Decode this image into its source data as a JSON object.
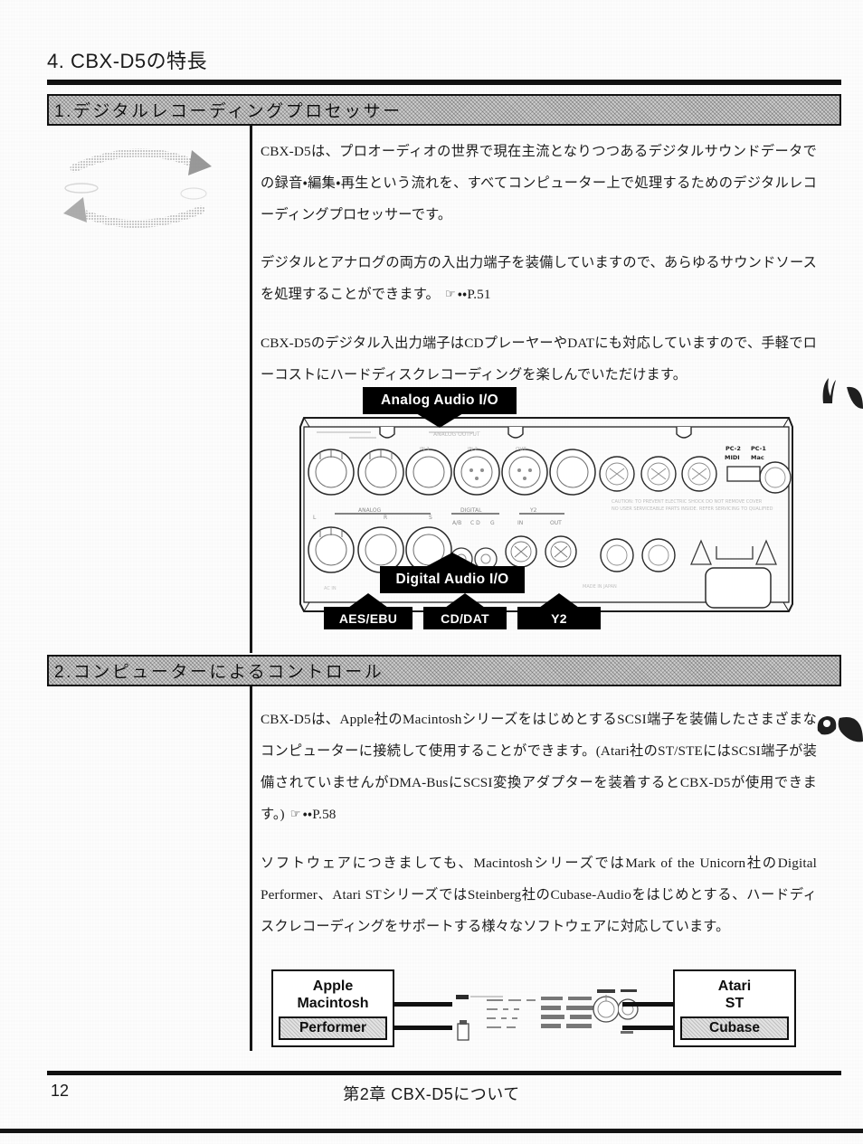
{
  "document": {
    "chapter_title": "4. CBX-D5の特長",
    "footer": {
      "page_number": "12",
      "running_title": "第2章 CBX-D5について"
    }
  },
  "sections": [
    {
      "heading": "1.デジタルレコーディングプロセッサー",
      "margin_icon": "cycle-arrows-icon",
      "paragraphs": [
        "CBX-D5は、プロオーディオの世界で現在主流となりつつあるデジタルサウンドデータでの録音・編集・再生という流れを、すべてコンピューター上で処理するためのデジタルレコーディングプロセッサーです。",
        "デジタルとアナログの両方の入出力端子を装備していますので、あらゆるサウンドソースを処理することができます。",
        "CBX-D5のデジタル入出力端子はCDプレーヤーやDATにも対応していますので、手軽でローコストにハードディスクレコーディングを楽しんでいただけます。"
      ],
      "cross_reference": "・・P.51",
      "figure": {
        "name": "cbx-d5-rear-panel",
        "callouts": {
          "analog": "Analog Audio I/O",
          "digital": "Digital Audio I/O",
          "aes_ebu": "AES/EBU",
          "cd_dat": "CD/DAT",
          "y2": "Y2"
        },
        "panel_markings": {
          "midi_group": "PC-2  PC-1",
          "midi_labels": "MIDI    Mac"
        }
      }
    },
    {
      "heading": "2.コンピューターによるコントロール",
      "paragraphs": [
        "CBX-D5は、Apple社のMacintoshシリーズをはじめとするSCSI端子を装備したさまざまなコンピューターに接続して使用することができます。(Atari社のST/STEにはSCSI端子が装備されていませんがDMA-BusにSCSI変換アダプターを装着するとCBX-D5が使用できます。)",
        "ソフトウェアにつきましても、MacintoshシリーズではMark of the Unicorn社のDigital Performer、Atari STシリーズではSteinberg社のCubase-Audioをはじめとする、ハードディスクレコーディングをサポートする様々なソフトウェアに対応しています。"
      ],
      "cross_reference": "・・P.58",
      "figure": {
        "name": "computer-connection-diagram",
        "left_box": {
          "title": "Apple\nMacintosh",
          "title_line1": "Apple",
          "title_line2": "Macintosh",
          "software": "Performer"
        },
        "center_device": "cbx-d5-front-panel",
        "right_box": {
          "title_line1": "Atari",
          "title_line2": "ST",
          "software": "Cubase"
        }
      }
    }
  ],
  "colors": {
    "ink": "#111111",
    "band_fill": "#cdcdcd",
    "callout_fill": "#000000",
    "paper": "#fdfdfd"
  }
}
